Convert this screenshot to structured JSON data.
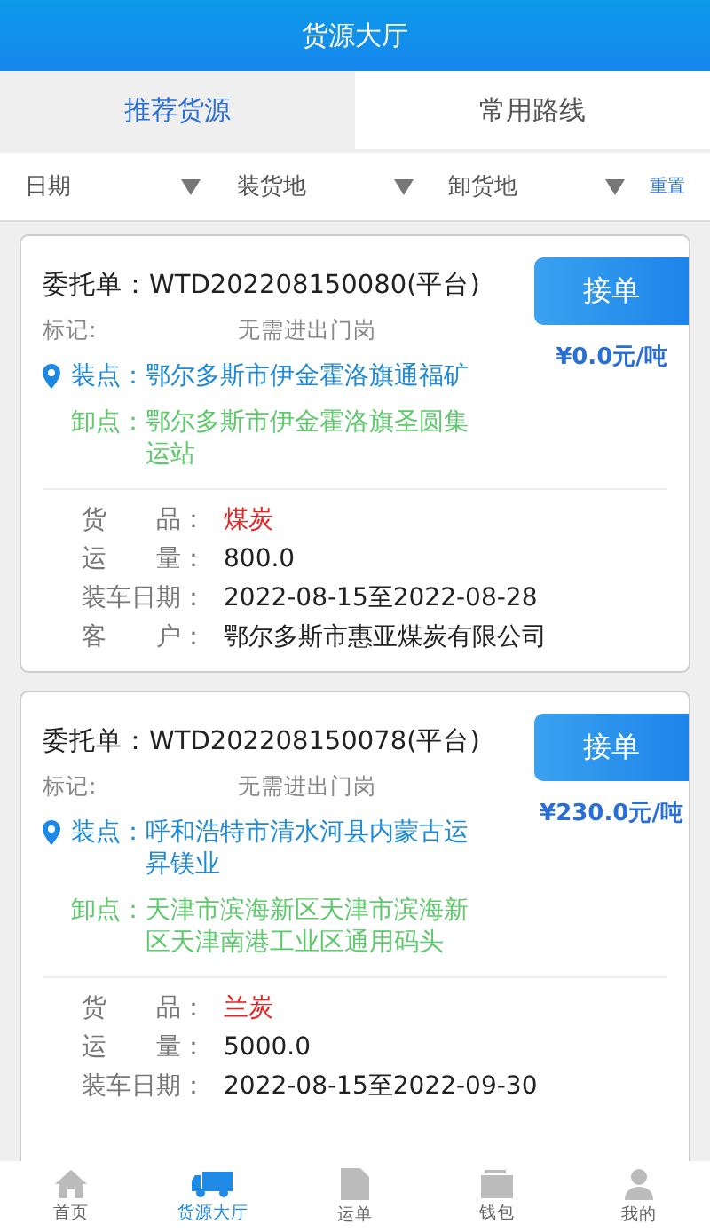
{
  "header": {
    "title": "货源大厅"
  },
  "tabs": [
    {
      "label": "推荐货源",
      "selected": true
    },
    {
      "label": "常用路线",
      "selected": false
    }
  ],
  "filters": [
    {
      "label": "日期"
    },
    {
      "label": "装货地"
    },
    {
      "label": "卸货地"
    }
  ],
  "reset": "重置",
  "orders": [
    {
      "title": "委托单：WTD202208150080(平台)",
      "action": "接单",
      "price": "¥0.0元/吨",
      "mark_label": "标记:",
      "mark_value": "无需进出门岗",
      "load_label": "装点：",
      "load": "鄂尔多斯市伊金霍洛旗通福矿",
      "unload_label": "卸点：",
      "unload": "鄂尔多斯市伊金霍洛旗圣圆集运站",
      "details": [
        {
          "label": "货　　品：",
          "value": "煤炭",
          "highlight": true
        },
        {
          "label": "运　　量：",
          "value": "800.0",
          "highlight": false
        },
        {
          "label": "装车日期：",
          "value": "2022-08-15至2022-08-28",
          "highlight": false
        },
        {
          "label": "客　　户：",
          "value": "鄂尔多斯市惠亚煤炭有限公司",
          "highlight": false
        }
      ]
    },
    {
      "title": "委托单：WTD202208150078(平台)",
      "action": "接单",
      "price": "¥230.0元/吨",
      "mark_label": "标记:",
      "mark_value": "无需进出门岗",
      "load_label": "装点：",
      "load": "呼和浩特市清水河县内蒙古运昇镁业",
      "unload_label": "卸点：",
      "unload": "天津市滨海新区天津市滨海新区天津南港工业区通用码头",
      "details": [
        {
          "label": "货　　品：",
          "value": "兰炭",
          "highlight": true
        },
        {
          "label": "运　　量：",
          "value": "5000.0",
          "highlight": false
        },
        {
          "label": "装车日期：",
          "value": "2022-08-15至2022-09-30",
          "highlight": false
        }
      ]
    }
  ],
  "nav": [
    {
      "kind": "home",
      "label": "首页",
      "selected": false
    },
    {
      "kind": "truck",
      "label": "货源大厅",
      "selected": true
    },
    {
      "kind": "doc",
      "label": "运单",
      "selected": false
    },
    {
      "kind": "wallet",
      "label": "钱包",
      "selected": false
    },
    {
      "kind": "user",
      "label": "我的",
      "selected": false
    }
  ]
}
